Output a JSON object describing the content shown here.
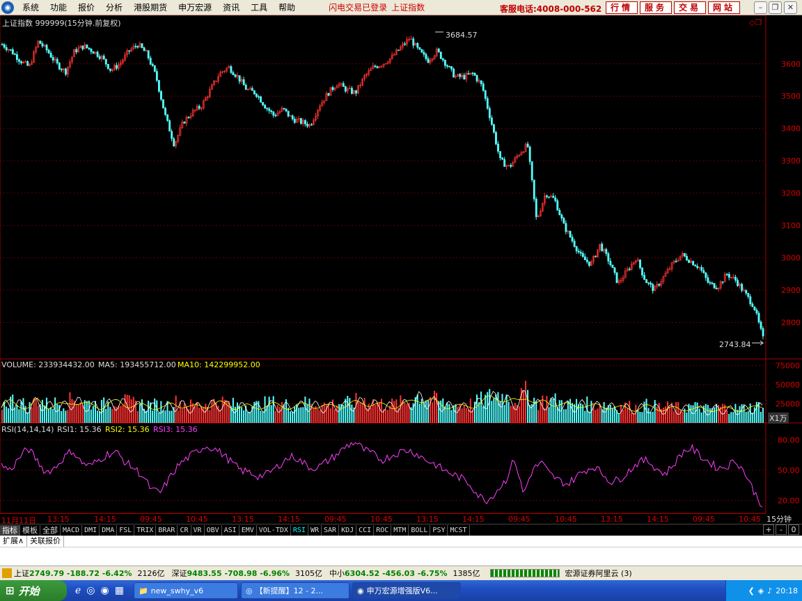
{
  "menubar": {
    "items": [
      "系统",
      "功能",
      "报价",
      "分析",
      "港股期货",
      "申万宏源",
      "资讯",
      "工具",
      "帮助"
    ],
    "notice1": "闪电交易已登录",
    "notice2": "上证指数",
    "hotline": "客服电话:4008-000-562",
    "buttons": [
      "行情",
      "服务",
      "交易",
      "网站"
    ]
  },
  "main_chart": {
    "title": "上证指数 999999(15分钟.前复权)",
    "high_label": "3684.57",
    "low_label": "2743.84",
    "y_ticks": [
      "3600",
      "3500",
      "3400",
      "3300",
      "3200",
      "3100",
      "3000",
      "2900",
      "2800"
    ]
  },
  "volume_panel": {
    "label": "VOLUME: 233934432.00",
    "ma5": "MA5: 193455712.00",
    "ma10": "MA10: 142299952.00",
    "y_ticks": [
      "75000",
      "50000",
      "25000"
    ],
    "unit": "X1万"
  },
  "rsi_panel": {
    "label": "RSI(14,14,14)",
    "rsi1": "RSI1: 15.36",
    "rsi2": "RSI2: 15.36",
    "rsi3": "RSI3: 15.36",
    "y_ticks": [
      "80.00",
      "50.00",
      "20.00"
    ]
  },
  "time_axis": {
    "labels": [
      "11月11日",
      "13:15",
      "14:15",
      "09:45",
      "10:45",
      "13:15",
      "14:15",
      "09:45",
      "10:45",
      "13:15",
      "14:15",
      "09:45",
      "10:45",
      "13:15",
      "14:15",
      "09:45",
      "10:45"
    ],
    "period": "15分钟"
  },
  "indicator_tabs": [
    "指标",
    "模板",
    "全部",
    "MACD",
    "DMI",
    "DMA",
    "FSL",
    "TRIX",
    "BRAR",
    "CR",
    "VR",
    "OBV",
    "ASI",
    "EMV",
    "VOL-TDX",
    "RSI",
    "WR",
    "SAR",
    "KDJ",
    "CCI",
    "ROC",
    "MTM",
    "BOLL",
    "PSY",
    "MCST"
  ],
  "ctl_buttons": [
    "+",
    "-",
    "0"
  ],
  "expand_tabs": [
    "扩展∧",
    "关联报价"
  ],
  "status": {
    "sh_name": "上证",
    "sh_value": "2749.79 -188.72 -6.42%",
    "sh_amount": "2126亿",
    "sz_name": "深证",
    "sz_value": "9483.55 -708.98 -6.96%",
    "sz_amount": "3105亿",
    "zx_name": "中小",
    "zx_value": "6304.52 -456.03 -6.75%",
    "zx_amount": "1385亿",
    "server": "宏源证券阿里云 (3)"
  },
  "taskbar": {
    "start": "开始",
    "tasks": [
      "new_swhy_v6",
      "【新提醒】12 - 2...",
      "申万宏源增强版V6..."
    ],
    "clock": "20:18"
  },
  "chart_data": {
    "type": "candlestick",
    "title": "上证指数 999999(15分钟.前复权)",
    "y_range": [
      2700,
      3720
    ],
    "close_series_estimate": [
      3660,
      3640,
      3610,
      3590,
      3670,
      3640,
      3600,
      3575,
      3640,
      3655,
      3640,
      3620,
      3580,
      3600,
      3640,
      3660,
      3630,
      3560,
      3440,
      3350,
      3420,
      3450,
      3470,
      3520,
      3570,
      3590,
      3560,
      3520,
      3510,
      3470,
      3440,
      3460,
      3430,
      3420,
      3410,
      3470,
      3510,
      3540,
      3520,
      3510,
      3560,
      3590,
      3600,
      3620,
      3650,
      3680,
      3640,
      3610,
      3640,
      3600,
      3560,
      3560,
      3570,
      3530,
      3420,
      3300,
      3280,
      3320,
      3350,
      3115,
      3200,
      3180,
      3100,
      3050,
      3000,
      2980,
      3040,
      2990,
      2920,
      2960,
      3000,
      2930,
      2900,
      2940,
      2980,
      3010,
      2990,
      2970,
      2920,
      2910,
      2950,
      2930,
      2890,
      2850,
      2750
    ],
    "volume_series_estimate": [
      230,
      300,
      270,
      210,
      320,
      240,
      260,
      250,
      330,
      270,
      250,
      230,
      280,
      300,
      260,
      250,
      240,
      230,
      220,
      270,
      260,
      220,
      240,
      260,
      280,
      250,
      230,
      240,
      220,
      250,
      260,
      240,
      230,
      250,
      270,
      240,
      230,
      260,
      250,
      280,
      300,
      270,
      250,
      240,
      260,
      280,
      360,
      330,
      290,
      250,
      240,
      230,
      250,
      300,
      350,
      380,
      310,
      300,
      420,
      260,
      300,
      290,
      260,
      240,
      270,
      230,
      250,
      240,
      210,
      220,
      200,
      230,
      220,
      200,
      210,
      190,
      220,
      200,
      180,
      210,
      200,
      190,
      200,
      210,
      234
    ],
    "rsi_series_estimate": [
      55,
      50,
      62,
      72,
      60,
      48,
      52,
      62,
      70,
      58,
      54,
      60,
      66,
      68,
      58,
      52,
      44,
      30,
      28,
      42,
      55,
      62,
      68,
      74,
      72,
      66,
      58,
      50,
      48,
      44,
      46,
      52,
      60,
      64,
      58,
      52,
      54,
      60,
      66,
      74,
      78,
      70,
      66,
      60,
      64,
      68,
      70,
      66,
      60,
      56,
      50,
      46,
      42,
      36,
      24,
      20,
      30,
      40,
      62,
      26,
      50,
      58,
      46,
      40,
      36,
      44,
      50,
      54,
      46,
      38,
      42,
      50,
      58,
      60,
      52,
      46,
      56,
      68,
      72,
      64,
      58,
      52,
      54,
      60,
      48,
      30,
      15
    ]
  }
}
